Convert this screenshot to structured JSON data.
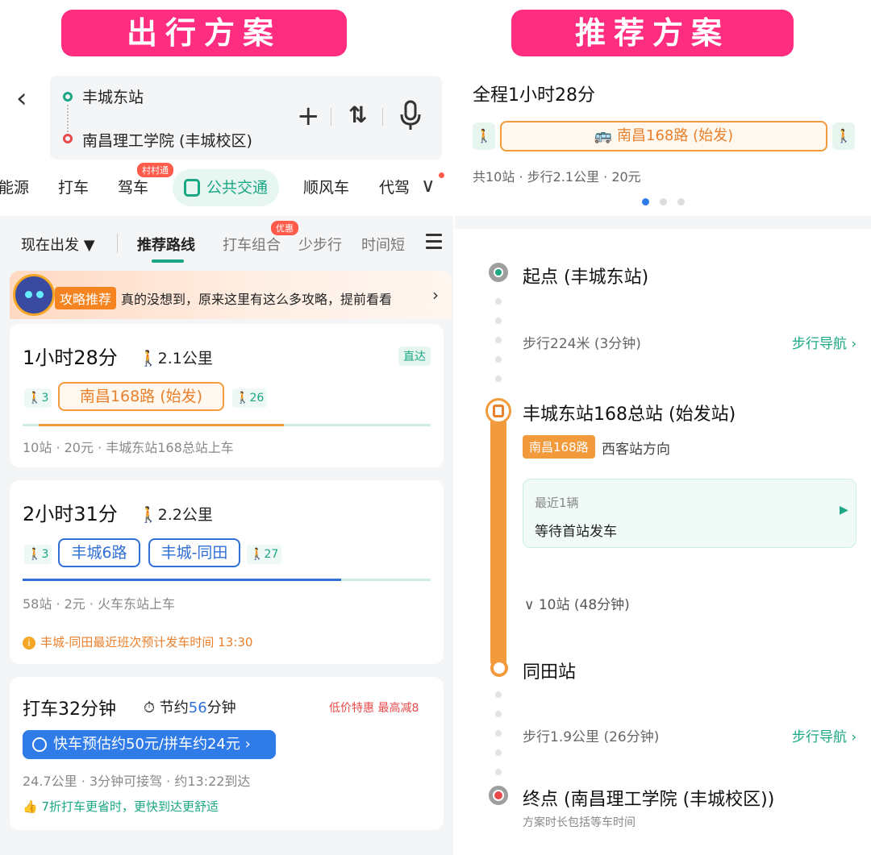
{
  "banners": {
    "left": "出行方案",
    "right": "推荐方案"
  },
  "search": {
    "origin": "丰城东站",
    "destination": "南昌理工学院 (丰城校区)"
  },
  "modes": {
    "items": [
      "能源",
      "打车",
      "驾车",
      "公共交通",
      "顺风车",
      "代驾"
    ],
    "driving_badge": "村村通"
  },
  "filters": {
    "depart": "现在出发 ▼",
    "items": [
      "推荐路线",
      "打车组合",
      "少步行",
      "时间短"
    ],
    "combo_badge": "优惠"
  },
  "guide": {
    "tag": "攻略推荐",
    "text": "真的没想到，原来这里有这么多攻略，提前看看"
  },
  "routes": [
    {
      "duration": "1小时28分",
      "walk": "2.1公里",
      "tag": "直达",
      "walk_before": "3",
      "lines": [
        "南昌168路 (始发)"
      ],
      "walk_after": "26",
      "meta": "10站 · 20元 · 丰城东站168总站上车",
      "progress": {
        "seg_start": 0.04,
        "seg_end": 0.64
      }
    },
    {
      "duration": "2小时31分",
      "walk": "2.2公里",
      "walk_before": "3",
      "lines": [
        "丰城6路",
        "丰城-同田"
      ],
      "walk_after": "27",
      "meta": "58站 · 2元 · 火车东站上车",
      "notice": "丰城-同田最近班次预计发车时间 13:30",
      "progress": {
        "seg_start": 0.0,
        "seg_end": 0.78
      }
    }
  ],
  "taxi": {
    "title": "打车32分钟",
    "save_prefix": "节约",
    "save_value": "56",
    "save_suffix": "分钟",
    "promo": "低价特惠  最高减8",
    "button": "快车预估约50元/拼车约24元 ›",
    "meta": "24.7公里 · 3分钟可接驾 · 约13:22到达",
    "tip": "7折打车更省时，更快到达更舒适"
  },
  "detail": {
    "total": "全程1小时28分",
    "line": "南昌168路 (始发)",
    "summary": "共10站 · 步行2.1公里 · 20元",
    "start": "起点 (丰城东站)",
    "walk1": "步行224米 (3分钟)",
    "nav_label": "步行导航 ›",
    "board_stop": "丰城东站168总站 (始发站)",
    "line_badge": "南昌168路",
    "direction": "西客站方向",
    "next_label": "最近1辆",
    "next_value": "等待首站发车",
    "stops": "∨ 10站 (48分钟)",
    "alight_stop": "同田站",
    "walk2": "步行1.9公里 (26分钟)",
    "end": "终点 (南昌理工学院 (丰城校区))",
    "note": "方案时长包括等车时间"
  },
  "colors": {
    "accent": "#1ba784",
    "brand_pink": "#ff2d7f",
    "bus_orange": "#f29a3c",
    "blue": "#2f6fd6"
  }
}
